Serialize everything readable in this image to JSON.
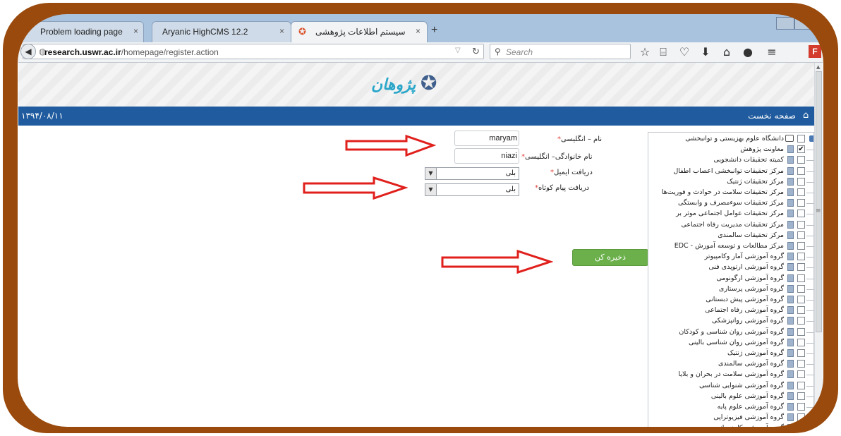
{
  "tabs": [
    {
      "label": "Problem loading page",
      "close": "×"
    },
    {
      "label": "Aryanic HighCMS 12.2",
      "close": "×"
    },
    {
      "label": "سیستم اطلاعات پژوهشی",
      "close": "×"
    }
  ],
  "new_tab": "+",
  "address_bar": {
    "url_host": "research.uswr.ac.ir",
    "url_path": "/homepage/register.action",
    "search_placeholder": "Search"
  },
  "toolbar_icons": [
    "star-icon",
    "bookmarks-icon",
    "pocket-icon",
    "download-icon",
    "home-icon",
    "chat-icon",
    "menu-icon"
  ],
  "toolbar_glyphs": [
    "☆",
    "⌸",
    "♡",
    "⬇",
    "⌂",
    "●",
    "≡"
  ],
  "addon_label": "F",
  "header": {
    "logo_text": "پژوهان",
    "home_label": "صفحه نخست",
    "date": "۱۳۹۴/۰۸/۱۱"
  },
  "form": {
    "first_name_label": "نام – انگلیسی",
    "first_name_value": "maryam",
    "last_name_label": "نام خانوادگی– انگلیسی",
    "last_name_value": "niazi",
    "email_label": "دریافت ایمیل",
    "email_value": "بلی",
    "sms_label": "دریافت پیام کوتاه",
    "sms_value": "بلی",
    "required_mark": "*",
    "save_label": "ذخیره کن"
  },
  "tree": {
    "root": "دانشگاه علوم بهزیستی و توانبخشی",
    "items": [
      {
        "label": "معاونت پژوهش",
        "checked": true
      },
      {
        "label": "کمیته تحقیقات دانشجویی",
        "checked": false
      },
      {
        "label": "مرکز تحقیقات توانبخشی اعصاب اطفال",
        "checked": false
      },
      {
        "label": "مرکز تحقیقات ژنتیک",
        "checked": false
      },
      {
        "label": "مرکز تحقیقات سلامت در حوادث و فوریت‌ها",
        "checked": false
      },
      {
        "label": "مرکز تحقیقات سوءمصرف و وابستگی",
        "checked": false
      },
      {
        "label": "مرکز تحقیقات عوامل اجتماعی موثر بر",
        "checked": false
      },
      {
        "label": "مرکز تحقیقات مدیریت رفاه اجتماعی",
        "checked": false
      },
      {
        "label": "مرکز تحقیقات سالمندی",
        "checked": false
      },
      {
        "label": "مرکز مطالعات و توسعه آموزش - EDC",
        "checked": false
      },
      {
        "label": "گروه آموزشی آمار وکامپیوتر",
        "checked": false
      },
      {
        "label": "گروه آموزشی ارتوپدی فنی",
        "checked": false
      },
      {
        "label": "گروه آموزشی ارگونومی",
        "checked": false
      },
      {
        "label": "گروه آموزشی پرستاری",
        "checked": false
      },
      {
        "label": "گروه آموزشی پیش دبستانی",
        "checked": false
      },
      {
        "label": "گروه آموزشی رفاه اجتماعی",
        "checked": false
      },
      {
        "label": "گروه آموزشی روانپزشکی",
        "checked": false
      },
      {
        "label": "گروه آموزشی روان شناسی و کودکان",
        "checked": false
      },
      {
        "label": "گروه آموزشی روان شناسی بالینی",
        "checked": false
      },
      {
        "label": "گروه آموزشی ژنتیک",
        "checked": false
      },
      {
        "label": "گروه آموزشی سالمندی",
        "checked": false
      },
      {
        "label": "گروه آموزشی سلامت در بحران و بلایا",
        "checked": false
      },
      {
        "label": "گروه آموزشی شنوایی شناسی",
        "checked": false
      },
      {
        "label": "گروه آموزشی علوم بالینی",
        "checked": false
      },
      {
        "label": "گروه آموزشی علوم پایه",
        "checked": false
      },
      {
        "label": "گروه آموزشی فیزیوتراپی",
        "checked": false
      },
      {
        "label": "گروه آموزشی کاردرمانی",
        "checked": false
      }
    ]
  },
  "colors": {
    "frame": "#9a4a0c",
    "header_bar": "#1f5b9e",
    "save_button": "#6bb04b",
    "arrow": "#e0201c"
  }
}
